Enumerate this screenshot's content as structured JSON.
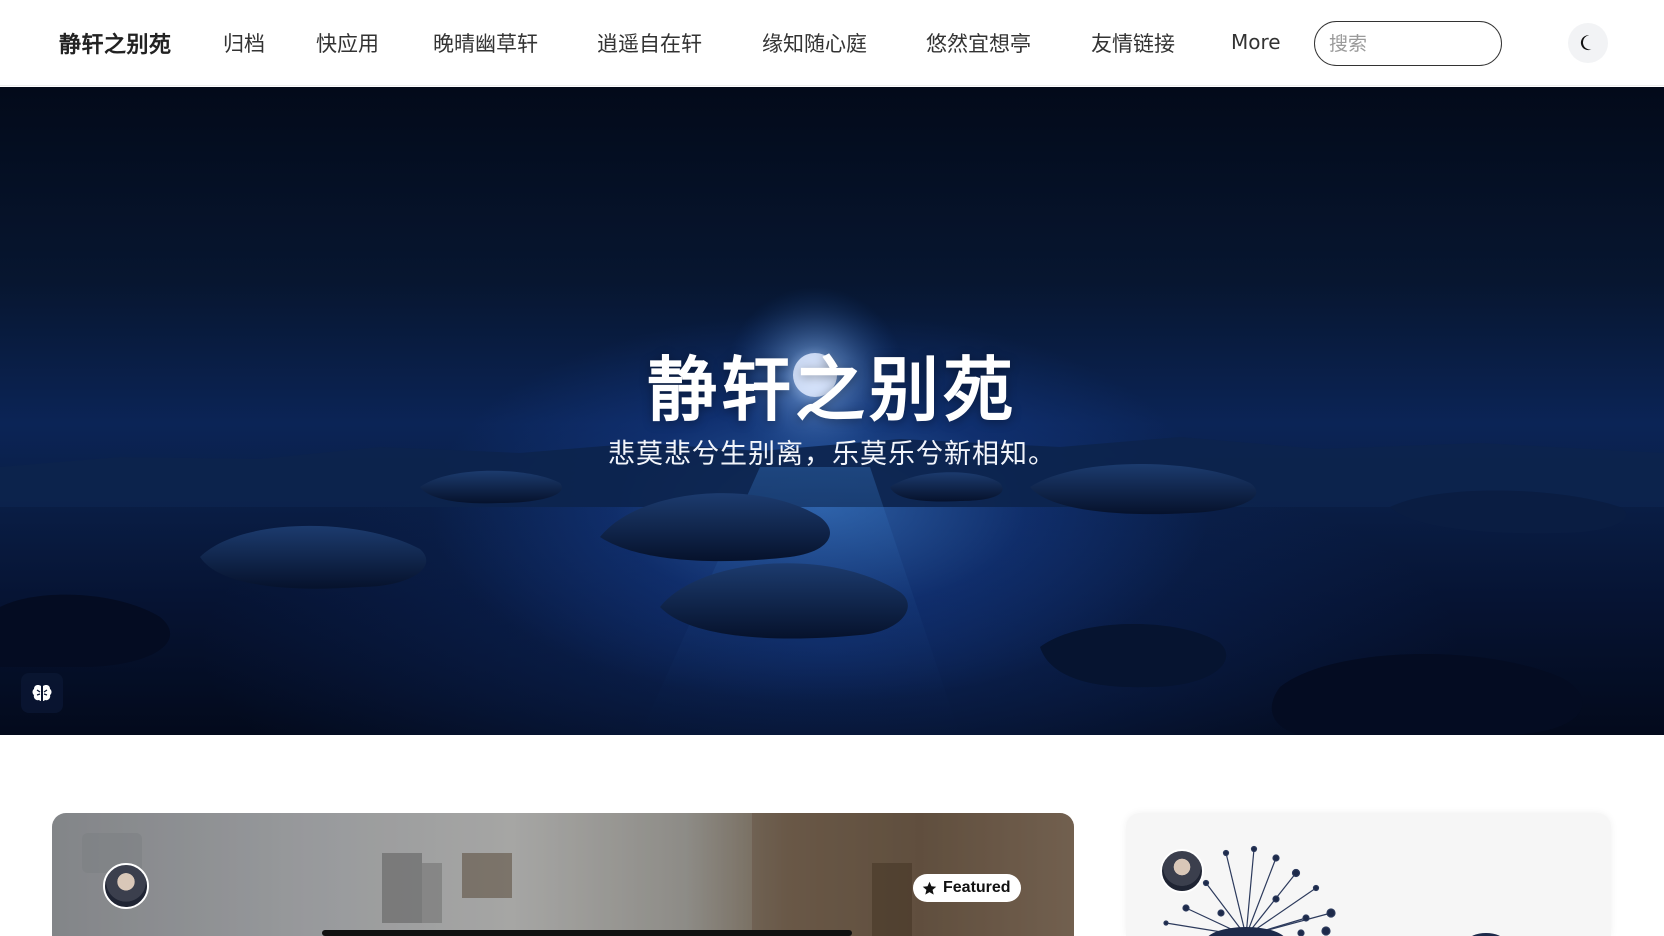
{
  "header": {
    "brand": "静轩之别苑",
    "nav": [
      {
        "label": "归档"
      },
      {
        "label": "快应用"
      },
      {
        "label": "晚晴幽草轩"
      },
      {
        "label": "逍遥自在轩"
      },
      {
        "label": "缘知随心庭"
      },
      {
        "label": "悠然宜想亭"
      },
      {
        "label": "友情链接"
      }
    ],
    "more_label": "More",
    "search_placeholder": "搜索",
    "theme_icon": "moon-icon"
  },
  "hero": {
    "title": "静轩之别苑",
    "subtitle": "悲莫悲兮生别离，乐莫乐兮新相知。",
    "badge_icon": "brain-icon"
  },
  "featured_card": {
    "badge_label": "Featured",
    "badge_icon": "star-icon"
  },
  "colors": {
    "accent": "#222222",
    "hero_dark": "#071630",
    "hero_glow": "#468ce6"
  }
}
